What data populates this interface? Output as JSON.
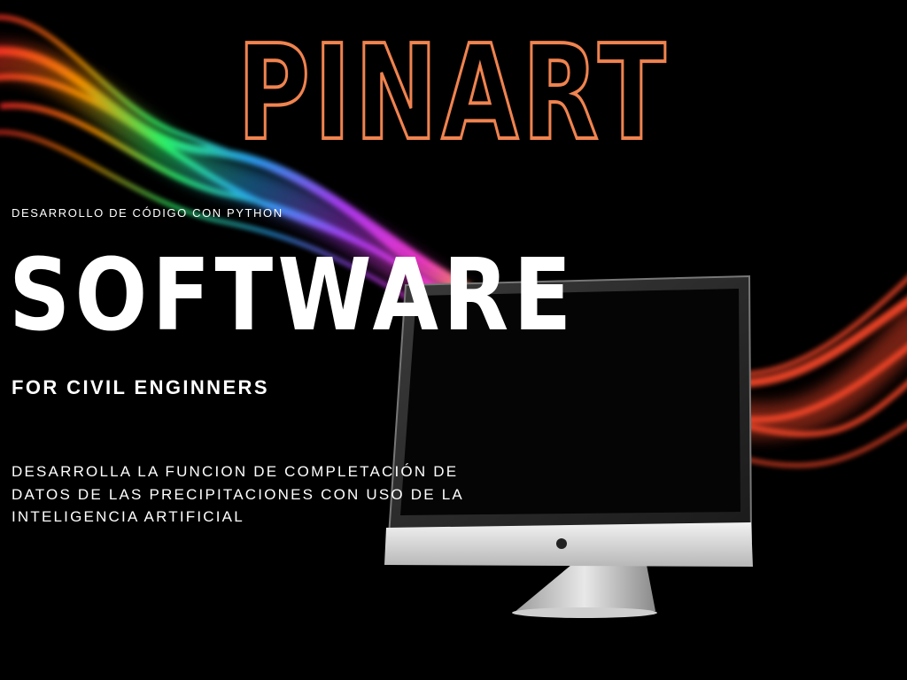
{
  "brand": {
    "title": "PINART",
    "outline_color": "#f0834f"
  },
  "kicker": "DESARROLLO DE CÓDIGO CON PYTHON",
  "headline": "SOFTWARE",
  "subtitle": "FOR CIVIL ENGINNERS",
  "description": {
    "line1": "DESARROLLA LA FUNCION DE COMPLETACIÓN DE",
    "line2": "DATOS DE LAS PRECIPITACIONES CON USO DE LA",
    "line3": "INTELIGENCIA ARTIFICIAL"
  },
  "colors": {
    "background": "#000000",
    "text": "#ffffff"
  },
  "illustrations": {
    "monitor": "desktop-monitor-icon",
    "ribbon": "rainbow-smoke-ribbon"
  }
}
